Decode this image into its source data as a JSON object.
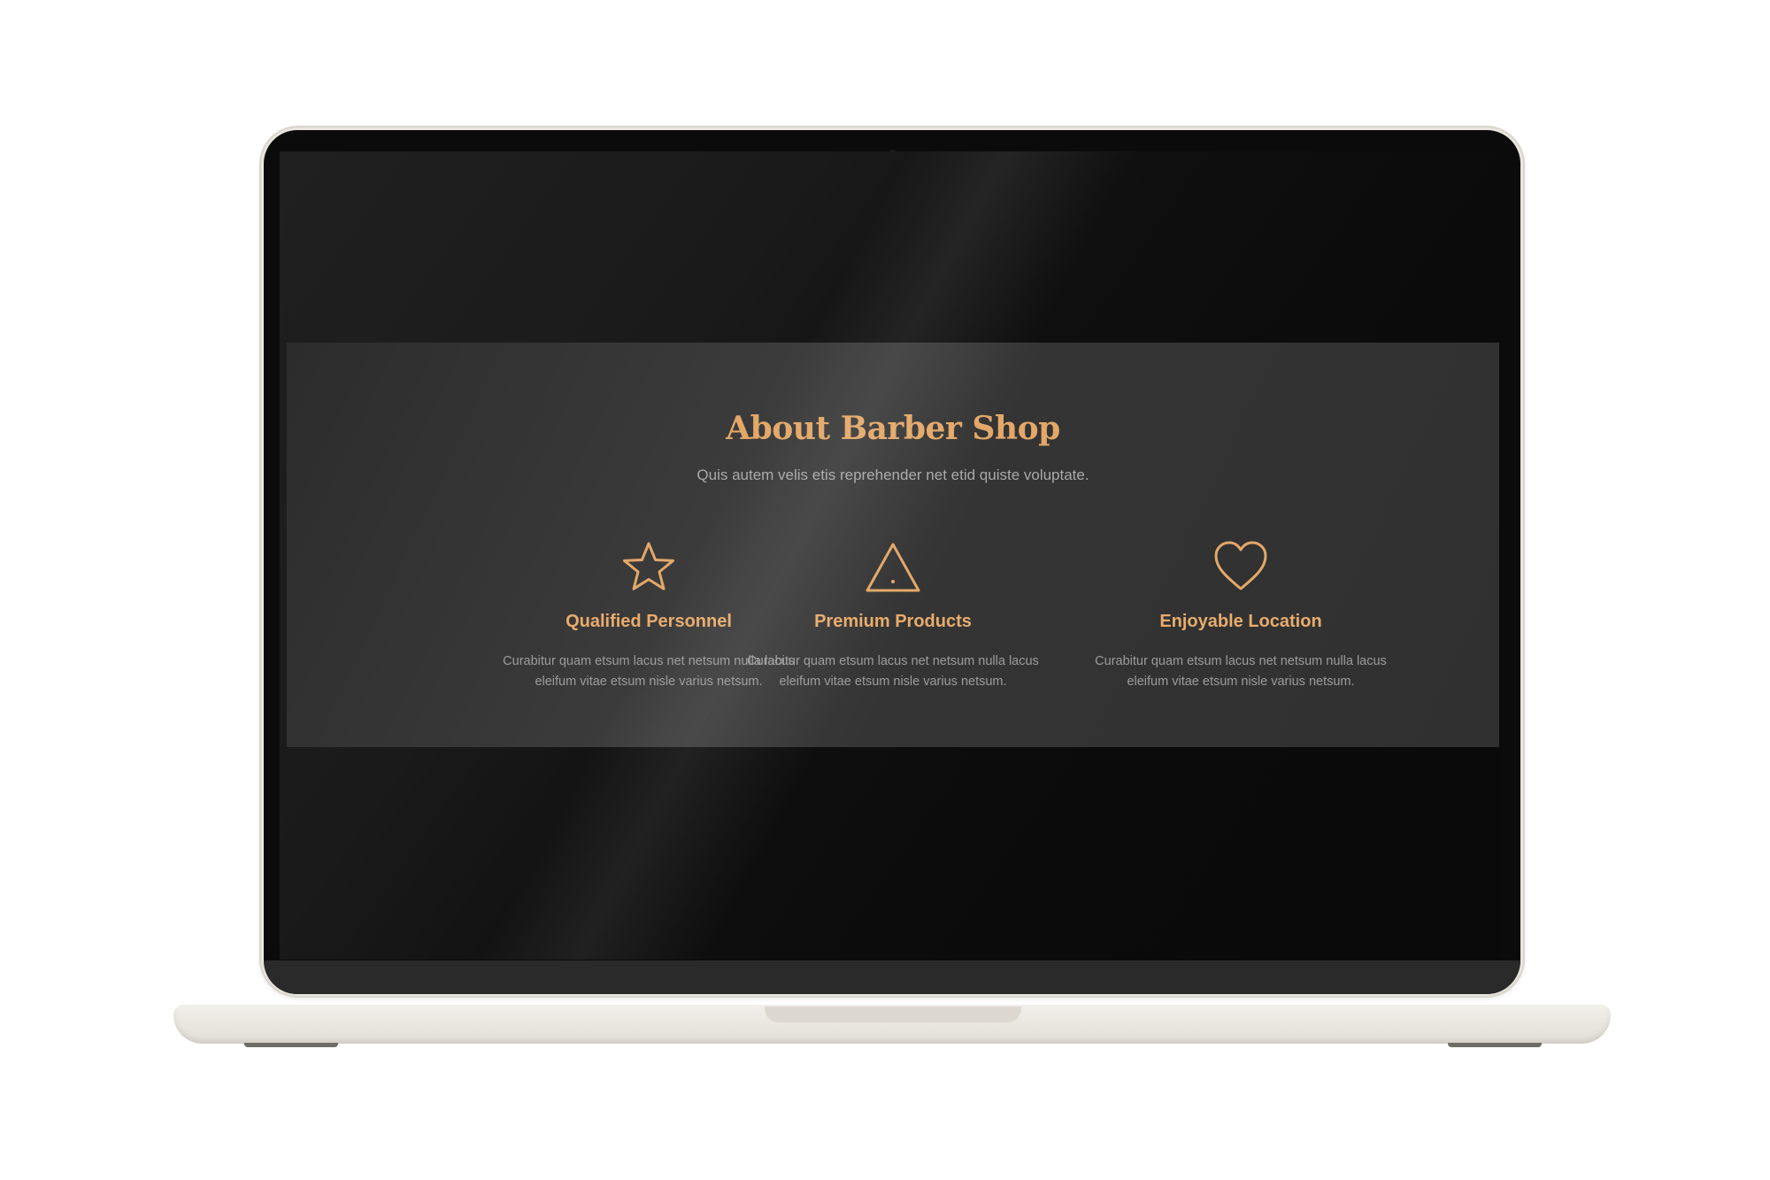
{
  "about": {
    "title": "About Barber Shop",
    "subtitle": "Quis autem velis etis reprehender net etid quiste voluptate."
  },
  "features": [
    {
      "icon": "star-icon",
      "title": "Qualified Personnel",
      "text": "Curabitur quam etsum lacus net netsum nulla lacus eleifum vitae etsum nisle varius netsum."
    },
    {
      "icon": "triangle-icon",
      "title": "Premium Products",
      "text": "Curabitur quam etsum lacus net netsum nulla lacus eleifum vitae etsum nisle varius netsum."
    },
    {
      "icon": "heart-icon",
      "title": "Enjoyable Location",
      "text": "Curabitur quam etsum lacus net netsum nulla lacus eleifum vitae etsum nisle varius netsum."
    }
  ],
  "colors": {
    "accent": "#e3a868",
    "section_bg": "#363636",
    "page_bg": "#0b0b0b",
    "body_text": "#9c9c9c"
  }
}
